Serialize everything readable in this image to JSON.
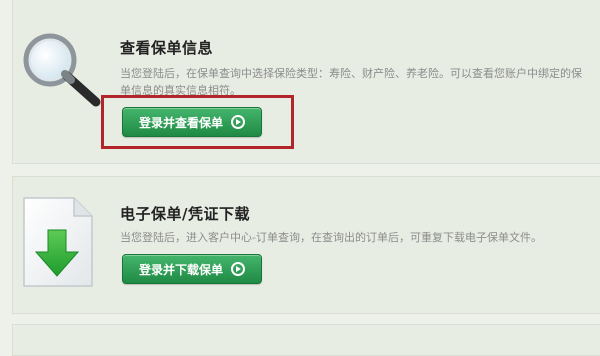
{
  "sections": [
    {
      "title": "查看保单信息",
      "description": "当您登陆后，在保单查询中选择保险类型：寿险、财产险、养老险。可以查看您账户中绑定的保单信息的真实信息相符。",
      "button_label": "登录并查看保单",
      "icon": "magnifier-icon"
    },
    {
      "title": "电子保单/凭证下载",
      "description": "当您登陆后，进入客户中心-订单查询，在查询出的订单后，可重复下载电子保单文件。",
      "button_label": "登录并下载保单",
      "icon": "download-document-icon"
    }
  ],
  "colors": {
    "button_green": "#1f8a45",
    "highlight_red": "#b2252b",
    "background": "#eef1ea"
  }
}
